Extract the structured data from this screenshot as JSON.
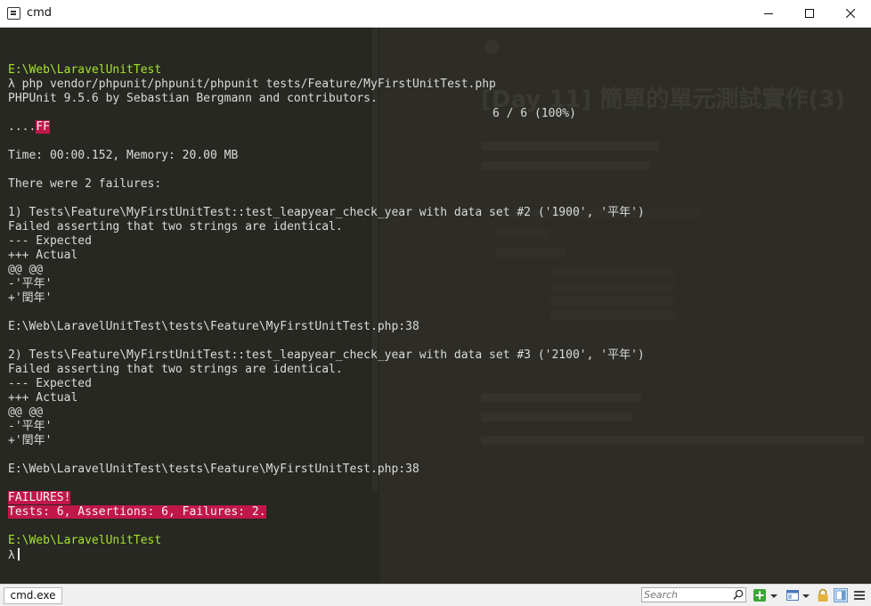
{
  "window": {
    "title": "cmd"
  },
  "terminal": {
    "lines": [
      {
        "segments": [
          {
            "text": "",
            "cls": ""
          }
        ]
      },
      {
        "segments": [
          {
            "text": "E:\\Web\\LaravelUnitTest",
            "cls": "green"
          }
        ]
      },
      {
        "segments": [
          {
            "text": "λ php vendor/phpunit/phpunit/phpunit tests/Feature/MyFirstUnitTest.php",
            "cls": ""
          }
        ]
      },
      {
        "segments": [
          {
            "text": "PHPUnit 9.5.6 by Sebastian Bergmann and contributors.",
            "cls": ""
          }
        ]
      },
      {
        "segments": [
          {
            "text": "",
            "cls": ""
          }
        ]
      },
      {
        "segments": [
          {
            "text": "....",
            "cls": ""
          },
          {
            "text": "FF",
            "cls": "err"
          }
        ]
      },
      {
        "segments": [
          {
            "text": "",
            "cls": ""
          }
        ]
      },
      {
        "segments": [
          {
            "text": "Time: 00:00.152, Memory: 20.00 MB",
            "cls": ""
          }
        ]
      },
      {
        "segments": [
          {
            "text": "",
            "cls": ""
          }
        ]
      },
      {
        "segments": [
          {
            "text": "There were 2 failures:",
            "cls": ""
          }
        ]
      },
      {
        "segments": [
          {
            "text": "",
            "cls": ""
          }
        ]
      },
      {
        "segments": [
          {
            "text": "1) Tests\\Feature\\MyFirstUnitTest::test_leapyear_check_year with data set #2 ('1900', '平年')",
            "cls": ""
          }
        ]
      },
      {
        "segments": [
          {
            "text": "Failed asserting that two strings are identical.",
            "cls": ""
          }
        ]
      },
      {
        "segments": [
          {
            "text": "--- Expected",
            "cls": ""
          }
        ]
      },
      {
        "segments": [
          {
            "text": "+++ Actual",
            "cls": ""
          }
        ]
      },
      {
        "segments": [
          {
            "text": "@@ @@",
            "cls": ""
          }
        ]
      },
      {
        "segments": [
          {
            "text": "-'平年'",
            "cls": ""
          }
        ]
      },
      {
        "segments": [
          {
            "text": "+'閏年'",
            "cls": ""
          }
        ]
      },
      {
        "segments": [
          {
            "text": "",
            "cls": ""
          }
        ]
      },
      {
        "segments": [
          {
            "text": "E:\\Web\\LaravelUnitTest\\tests\\Feature\\MyFirstUnitTest.php:38",
            "cls": ""
          }
        ]
      },
      {
        "segments": [
          {
            "text": "",
            "cls": ""
          }
        ]
      },
      {
        "segments": [
          {
            "text": "2) Tests\\Feature\\MyFirstUnitTest::test_leapyear_check_year with data set #3 ('2100', '平年')",
            "cls": ""
          }
        ]
      },
      {
        "segments": [
          {
            "text": "Failed asserting that two strings are identical.",
            "cls": ""
          }
        ]
      },
      {
        "segments": [
          {
            "text": "--- Expected",
            "cls": ""
          }
        ]
      },
      {
        "segments": [
          {
            "text": "+++ Actual",
            "cls": ""
          }
        ]
      },
      {
        "segments": [
          {
            "text": "@@ @@",
            "cls": ""
          }
        ]
      },
      {
        "segments": [
          {
            "text": "-'平年'",
            "cls": ""
          }
        ]
      },
      {
        "segments": [
          {
            "text": "+'閏年'",
            "cls": ""
          }
        ]
      },
      {
        "segments": [
          {
            "text": "",
            "cls": ""
          }
        ]
      },
      {
        "segments": [
          {
            "text": "E:\\Web\\LaravelUnitTest\\tests\\Feature\\MyFirstUnitTest.php:38",
            "cls": ""
          }
        ]
      },
      {
        "segments": [
          {
            "text": "",
            "cls": ""
          }
        ]
      },
      {
        "segments": [
          {
            "text": "FAILURES!",
            "cls": "err"
          }
        ]
      },
      {
        "segments": [
          {
            "text": "Tests: 6, Assertions: 6, Failures: 2.",
            "cls": "err"
          }
        ]
      },
      {
        "segments": [
          {
            "text": "",
            "cls": ""
          }
        ]
      },
      {
        "segments": [
          {
            "text": "E:\\Web\\LaravelUnitTest",
            "cls": "green"
          }
        ]
      },
      {
        "segments": [
          {
            "text": "λ",
            "cls": ""
          }
        ],
        "cursor": true
      }
    ],
    "progress_text": "6 / 6 (100%)"
  },
  "background": {
    "title": "[Day 11] 簡單的單元測試實作(3)"
  },
  "statusbar": {
    "tab_label": "cmd.exe",
    "search_placeholder": "Search"
  },
  "icons": {
    "app": "console-icon",
    "minimize": "minimize-icon",
    "maximize": "maximize-icon",
    "close": "close-icon",
    "search": "search-icon",
    "new_tab": "plus-icon",
    "layout": "split-view-icon",
    "lock": "lock-icon",
    "panel": "panel-icon",
    "menu": "hamburger-menu-icon"
  },
  "colors": {
    "console_bg": "#272822",
    "prompt_green": "#a6e22e",
    "error_bg": "#c0174a",
    "text": "#dadada"
  }
}
